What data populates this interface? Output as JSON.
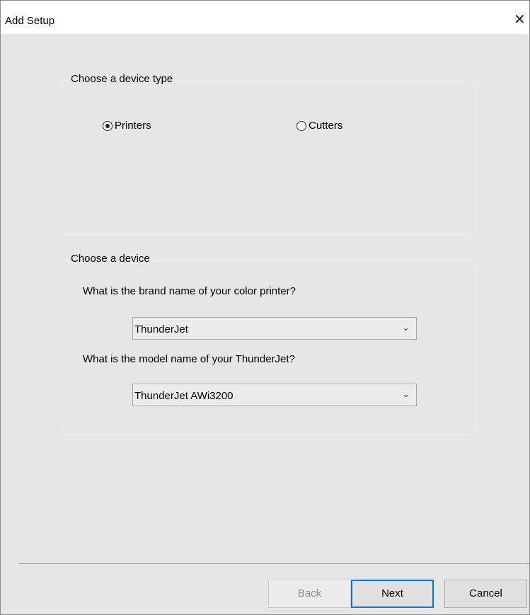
{
  "window": {
    "title": "Add Setup",
    "close_glyph": "✕"
  },
  "device_type": {
    "group_title": "Choose a device type",
    "options": [
      {
        "label": "Printers",
        "selected": true
      },
      {
        "label": "Cutters",
        "selected": false
      }
    ]
  },
  "device": {
    "group_title": "Choose a device",
    "brand_question": "What is the brand name of your color printer?",
    "brand_value": "ThunderJet",
    "model_question": "What is the model name of your ThunderJet?",
    "model_value": "ThunderJet AWi3200"
  },
  "buttons": {
    "back": "Back",
    "next": "Next",
    "cancel": "Cancel"
  },
  "icons": {
    "close": "close-icon",
    "dropdown": "chevron-down-icon"
  }
}
